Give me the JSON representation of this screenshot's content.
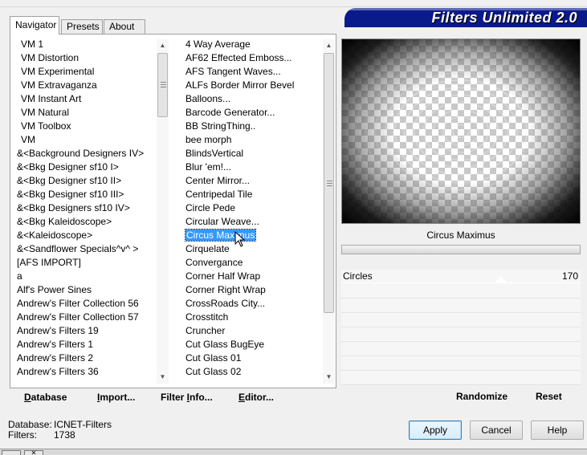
{
  "window": {
    "banner_title": "Filters Unlimited 2.0"
  },
  "tabs": [
    {
      "label": "Navigator",
      "active": true
    },
    {
      "label": "Presets",
      "active": false
    },
    {
      "label": "About",
      "active": false
    }
  ],
  "categories": [
    {
      "label": "VM 1",
      "indent": true
    },
    {
      "label": "VM Distortion",
      "indent": true
    },
    {
      "label": "VM Experimental",
      "indent": true
    },
    {
      "label": "VM Extravaganza",
      "indent": true
    },
    {
      "label": "VM Instant Art",
      "indent": true
    },
    {
      "label": "VM Natural",
      "indent": true
    },
    {
      "label": "VM Toolbox",
      "indent": true
    },
    {
      "label": "VM",
      "indent": true
    },
    {
      "label": "&<Background Designers IV>",
      "indent": false
    },
    {
      "label": "&<Bkg Designer sf10 I>",
      "indent": false
    },
    {
      "label": "&<Bkg Designer sf10 II>",
      "indent": false
    },
    {
      "label": "&<Bkg Designer sf10 III>",
      "indent": false
    },
    {
      "label": "&<Bkg Designers sf10 IV>",
      "indent": false
    },
    {
      "label": "&<Bkg Kaleidoscope>",
      "indent": false
    },
    {
      "label": "&<Kaleidoscope>",
      "indent": false
    },
    {
      "label": "&<Sandflower Specials^v^ >",
      "indent": false
    },
    {
      "label": "[AFS IMPORT]",
      "indent": false
    },
    {
      "label": "a",
      "indent": false
    },
    {
      "label": "Alf's Power Sines",
      "indent": false
    },
    {
      "label": "Andrew's Filter Collection 56",
      "indent": false
    },
    {
      "label": "Andrew's Filter Collection 57",
      "indent": false
    },
    {
      "label": "Andrew's Filters 19",
      "indent": false
    },
    {
      "label": "Andrew's Filters 1",
      "indent": false
    },
    {
      "label": "Andrew's Filters 2",
      "indent": false
    },
    {
      "label": "Andrew's Filters 36",
      "indent": false
    }
  ],
  "filters": [
    {
      "label": "4 Way Average",
      "selected": false
    },
    {
      "label": "AF62 Effected Emboss...",
      "selected": false
    },
    {
      "label": "AFS Tangent Waves...",
      "selected": false
    },
    {
      "label": "ALFs Border Mirror Bevel",
      "selected": false
    },
    {
      "label": "Balloons...",
      "selected": false
    },
    {
      "label": "Barcode Generator...",
      "selected": false
    },
    {
      "label": "BB StringThing..",
      "selected": false
    },
    {
      "label": "bee morph",
      "selected": false
    },
    {
      "label": "BlindsVertical",
      "selected": false
    },
    {
      "label": "Blur 'em!...",
      "selected": false
    },
    {
      "label": "Center Mirror...",
      "selected": false
    },
    {
      "label": "Centripedal Tile",
      "selected": false
    },
    {
      "label": "Circle Pede",
      "selected": false
    },
    {
      "label": "Circular Weave...",
      "selected": false
    },
    {
      "label": "Circus Maximus",
      "selected": true
    },
    {
      "label": "Cirquelate",
      "selected": false
    },
    {
      "label": "Convergance",
      "selected": false
    },
    {
      "label": "Corner Half Wrap",
      "selected": false
    },
    {
      "label": "Corner Right Wrap",
      "selected": false
    },
    {
      "label": "CrossRoads City...",
      "selected": false
    },
    {
      "label": "Crosstitch",
      "selected": false
    },
    {
      "label": "Cruncher",
      "selected": false
    },
    {
      "label": "Cut Glass  BugEye",
      "selected": false
    },
    {
      "label": "Cut Glass 01",
      "selected": false
    },
    {
      "label": "Cut Glass 02",
      "selected": false
    }
  ],
  "panel_buttons": {
    "database": {
      "label": "Database",
      "underline": "D",
      "rest": "atabase"
    },
    "import": {
      "label": "Import...",
      "underline": "I",
      "rest": "mport..."
    },
    "filter_info": {
      "pre": "Filter ",
      "underline": "I",
      "rest": "nfo..."
    },
    "editor": {
      "label": "Editor...",
      "underline": "E",
      "rest": "ditor..."
    }
  },
  "preview": {
    "filter_name": "Circus Maximus"
  },
  "params": [
    {
      "label": "Circles",
      "value": "170"
    }
  ],
  "preview_buttons": {
    "randomize": "Randomize",
    "reset": "Reset"
  },
  "status": {
    "database_label": "Database:",
    "database_value": "ICNET-Filters",
    "filters_label": "Filters:",
    "filters_value": "1738"
  },
  "dialog_buttons": {
    "apply": "Apply",
    "cancel": "Cancel",
    "help": "Help"
  },
  "taskbar": {
    "close_glyph": "✕"
  }
}
